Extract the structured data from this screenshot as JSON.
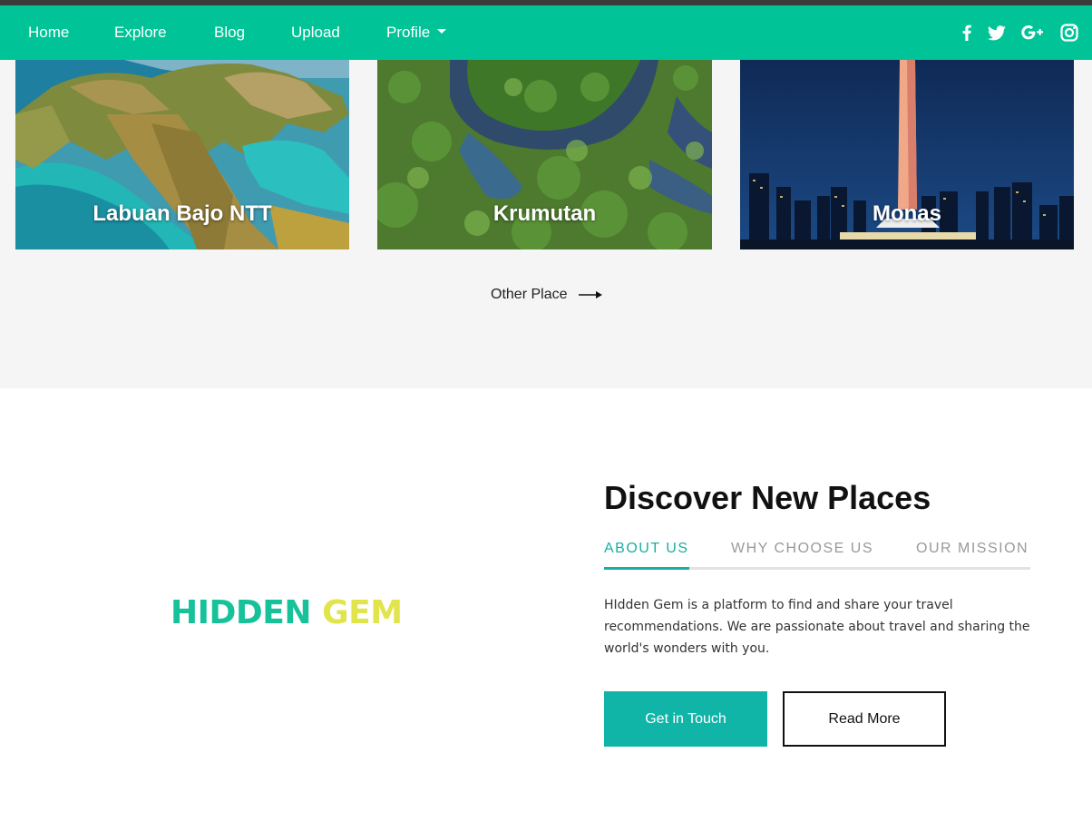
{
  "nav": {
    "items": [
      "Home",
      "Explore",
      "Blog",
      "Upload",
      "Profile"
    ],
    "social_icons": [
      "facebook-icon",
      "twitter-icon",
      "google-plus-icon",
      "instagram-icon"
    ]
  },
  "places": {
    "cards": [
      "Labuan Bajo NTT",
      "Krumutan",
      "Monas"
    ],
    "other_place_label": "Other Place"
  },
  "logo": {
    "word1": "HIDDEN",
    "word2": "GEM"
  },
  "about": {
    "heading": "Discover New Places",
    "tabs": [
      "ABOUT US",
      "WHY CHOOSE US",
      "OUR MISSION"
    ],
    "active_tab": "ABOUT US",
    "description": "HIdden Gem is a platform to find and share your travel recommendations. We are passionate about travel and sharing the world's wonders with you.",
    "primary_button": "Get in Touch",
    "secondary_button": "Read More"
  },
  "colors": {
    "navbar": "#00c497",
    "accent": "#1aaea2",
    "logo_green": "#17c29a",
    "logo_yellow": "#e2e44b"
  }
}
